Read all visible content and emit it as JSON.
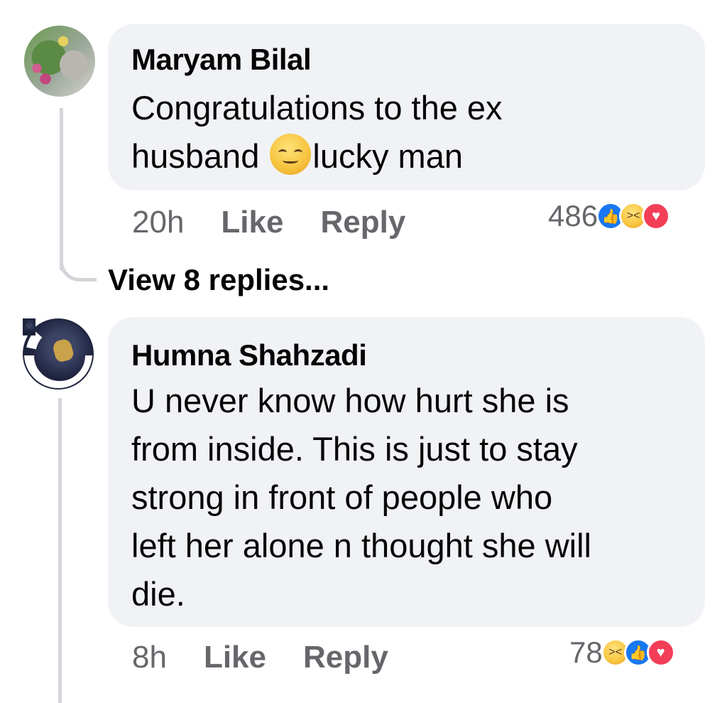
{
  "comments": [
    {
      "author": "Maryam Bilal",
      "text_line1": "Congratulations to the ex",
      "text_line2_a": "husband ",
      "text_line2_b": "lucky man",
      "time": "20h",
      "like_label": "Like",
      "reply_label": "Reply",
      "reaction_count": "486",
      "reactions": [
        "like-icon",
        "haha-icon",
        "love-icon"
      ]
    },
    {
      "author": "Humna Shahzadi",
      "text_lines": [
        "U never know how hurt she is",
        "from inside. This is just to stay",
        "strong in front of people who",
        "left her alone n thought she will",
        "die."
      ],
      "time": "8h",
      "like_label": "Like",
      "reply_label": "Reply",
      "reaction_count": "78",
      "reactions": [
        "haha-icon",
        "like-icon",
        "love-icon"
      ]
    }
  ],
  "view_replies_label": "View 8 replies...",
  "colors": {
    "bubble": "#f0f2f5",
    "meta_text": "#65676b",
    "like": "#1877f2",
    "love": "#f33e58"
  }
}
